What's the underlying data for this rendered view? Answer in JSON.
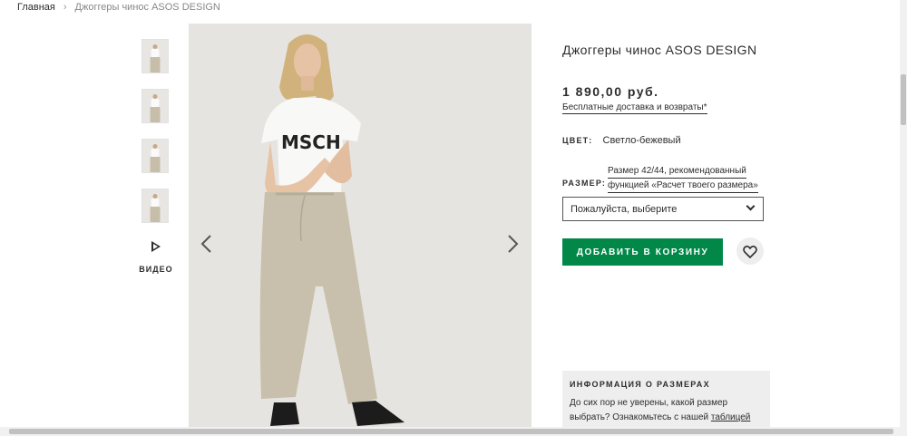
{
  "breadcrumb": {
    "home": "Главная",
    "separator": "›",
    "current": "Джоггеры чинос ASOS DESIGN"
  },
  "gallery": {
    "thumbnails_count": 4,
    "video_label": "ВИДЕО",
    "prev_icon": "chevron-left-icon",
    "next_icon": "chevron-right-icon"
  },
  "product": {
    "title": "Джоггеры чинос ASOS DESIGN",
    "price": "1 890,00 руб.",
    "delivery_link": "Бесплатные доставка и возвраты*",
    "color_label": "ЦВЕТ:",
    "color_value": "Светло-бежевый",
    "size_recommendation_line1": "Размер 42/44, рекомендованный",
    "size_recommendation_line2": "функцией «Расчет твоего размера»",
    "size_label": "РАЗМЕР:",
    "size_select_value": "Пожалуйста, выберите",
    "add_to_cart": "ДОБАВИТЬ В КОРЗИНУ"
  },
  "size_info": {
    "heading": "ИНФОРМАЦИЯ О РАЗМЕРАХ",
    "text_line1": "До сих пор не уверены, какой размер",
    "text_line2": "выбрать? Ознакомьтесь с нашей",
    "link": "таблицей"
  },
  "colors": {
    "accent_green": "#018849",
    "text": "#2d2d2d",
    "panel_bg": "#eeeeee"
  }
}
